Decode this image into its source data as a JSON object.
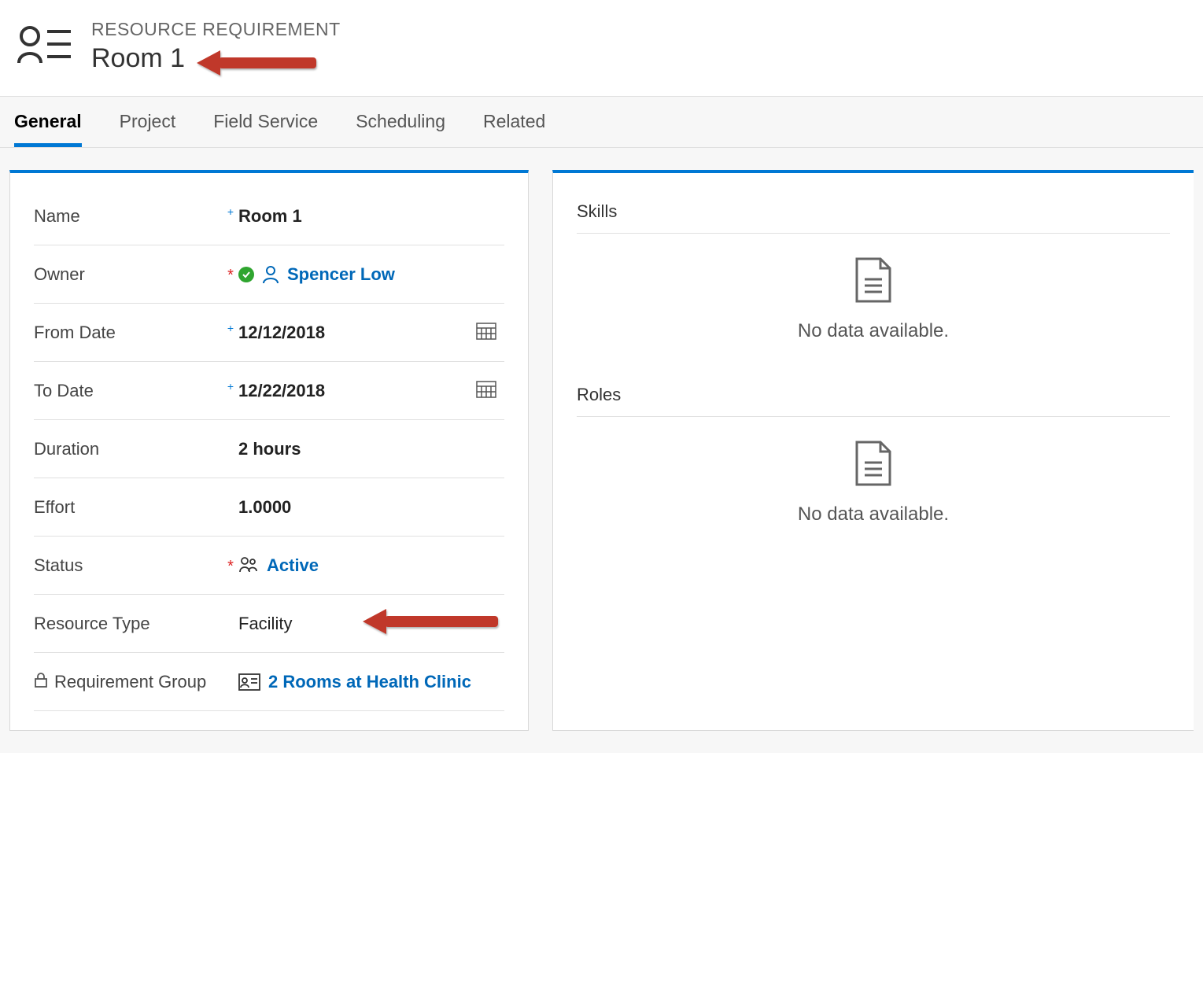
{
  "header": {
    "entityType": "RESOURCE REQUIREMENT",
    "title": "Room 1"
  },
  "tabs": [
    {
      "label": "General",
      "active": true
    },
    {
      "label": "Project",
      "active": false
    },
    {
      "label": "Field Service",
      "active": false
    },
    {
      "label": "Scheduling",
      "active": false
    },
    {
      "label": "Related",
      "active": false
    }
  ],
  "form": {
    "name": {
      "label": "Name",
      "value": "Room 1",
      "marker": "+"
    },
    "owner": {
      "label": "Owner",
      "value": "Spencer Low",
      "marker": "*"
    },
    "fromDate": {
      "label": "From Date",
      "value": "12/12/2018",
      "marker": "+"
    },
    "toDate": {
      "label": "To Date",
      "value": "12/22/2018",
      "marker": "+"
    },
    "duration": {
      "label": "Duration",
      "value": "2 hours"
    },
    "effort": {
      "label": "Effort",
      "value": "1.0000"
    },
    "status": {
      "label": "Status",
      "value": "Active",
      "marker": "*"
    },
    "resourceType": {
      "label": "Resource Type",
      "value": "Facility"
    },
    "requirementGroup": {
      "label": "Requirement Group",
      "value": "2 Rooms at Health Clinic"
    }
  },
  "rightPanel": {
    "skills": {
      "header": "Skills",
      "empty": "No data available."
    },
    "roles": {
      "header": "Roles",
      "empty": "No data available."
    }
  }
}
